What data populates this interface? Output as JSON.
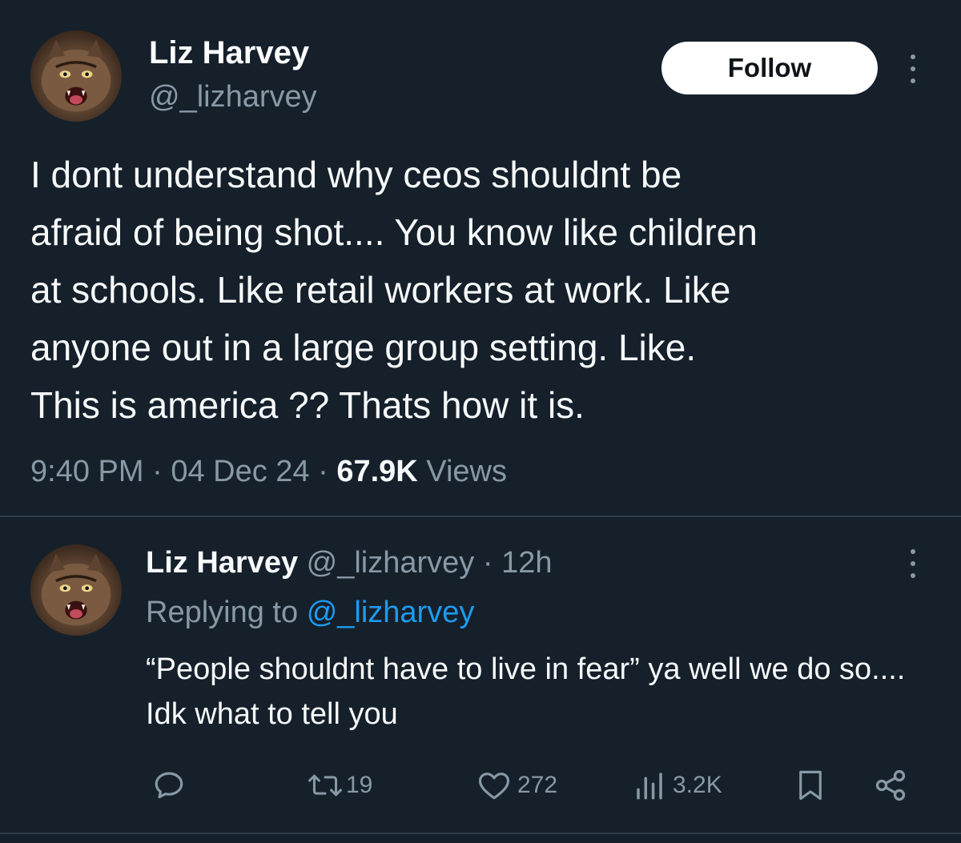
{
  "tweet": {
    "author_name": "Liz Harvey",
    "author_handle": "@_lizharvey",
    "follow_label": "Follow",
    "text": "I dont understand why ceos shouldnt be\nafraid of being shot.... You know like children\nat schools. Like retail workers at work. Like\nanyone out in a large group setting. Like.\nThis is america ?? Thats how it is.",
    "time": "9:40 PM",
    "date": "04 Dec 24",
    "views_count": "67.9K",
    "views_label": "Views",
    "separator": "·"
  },
  "reply": {
    "author_name": "Liz Harvey",
    "author_handle": "@_lizharvey",
    "age": "12h",
    "replying_prefix": "Replying to",
    "replying_to": "@_lizharvey",
    "text": "“People shouldnt have to live in fear” ya well we do so.... Idk what to tell you",
    "actions": {
      "reply_icon": "comment-icon",
      "retweet_icon": "retweet-icon",
      "retweet_count": "19",
      "like_icon": "heart-icon",
      "like_count": "272",
      "views_icon": "analytics-icon",
      "views_count": "3.2K",
      "bookmark_icon": "bookmark-icon",
      "share_icon": "share-icon"
    }
  },
  "colors": {
    "background": "#15202b",
    "primary_text": "#f7f9f9",
    "secondary_text": "#8899a6",
    "link": "#1d9bf0",
    "follow_button_bg": "#ffffff"
  }
}
